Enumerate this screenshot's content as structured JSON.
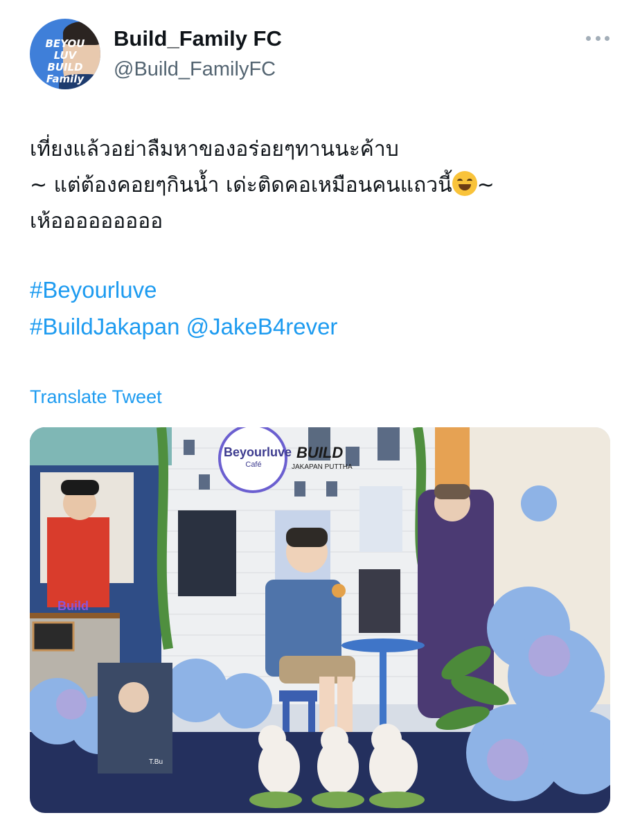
{
  "tweet": {
    "display_name": "Build_Family FC",
    "handle": "@Build_FamilyFC",
    "avatar_text": "BEYOU\nLUV\nBUILD\nFamily",
    "text_lines": [
      "เที่ยงแล้วอย่าลืมหาของอร่อยๆทานนะค้าบ",
      "~ แต่ต้องคอยๆกินน้ำ เด่ะติดคอเหมือนคนแถวนี้",
      "~",
      "เห้อออออออออ"
    ],
    "hashtag_1": "#Beyourluve",
    "hashtag_2": "#BuildJakapan",
    "mention": "@JakeB4rever",
    "translate_label": "Translate Tweet",
    "emoji": "rolling-on-floor-laughing-emoji",
    "more_icon": "more-dots-icon"
  },
  "photo": {
    "cafe_sign_name": "Beyourluve",
    "cafe_sign_sub": "Café",
    "build_sign": "BUILD",
    "build_sign_sub": "JAKAPAN PUTTHA",
    "cafe_counter_sign": "Build",
    "poster_caption": "T.Bu"
  },
  "colors": {
    "link": "#1d9bf0",
    "secondary_text": "#536471",
    "primary_text": "#0f1419",
    "background": "#ffffff"
  }
}
